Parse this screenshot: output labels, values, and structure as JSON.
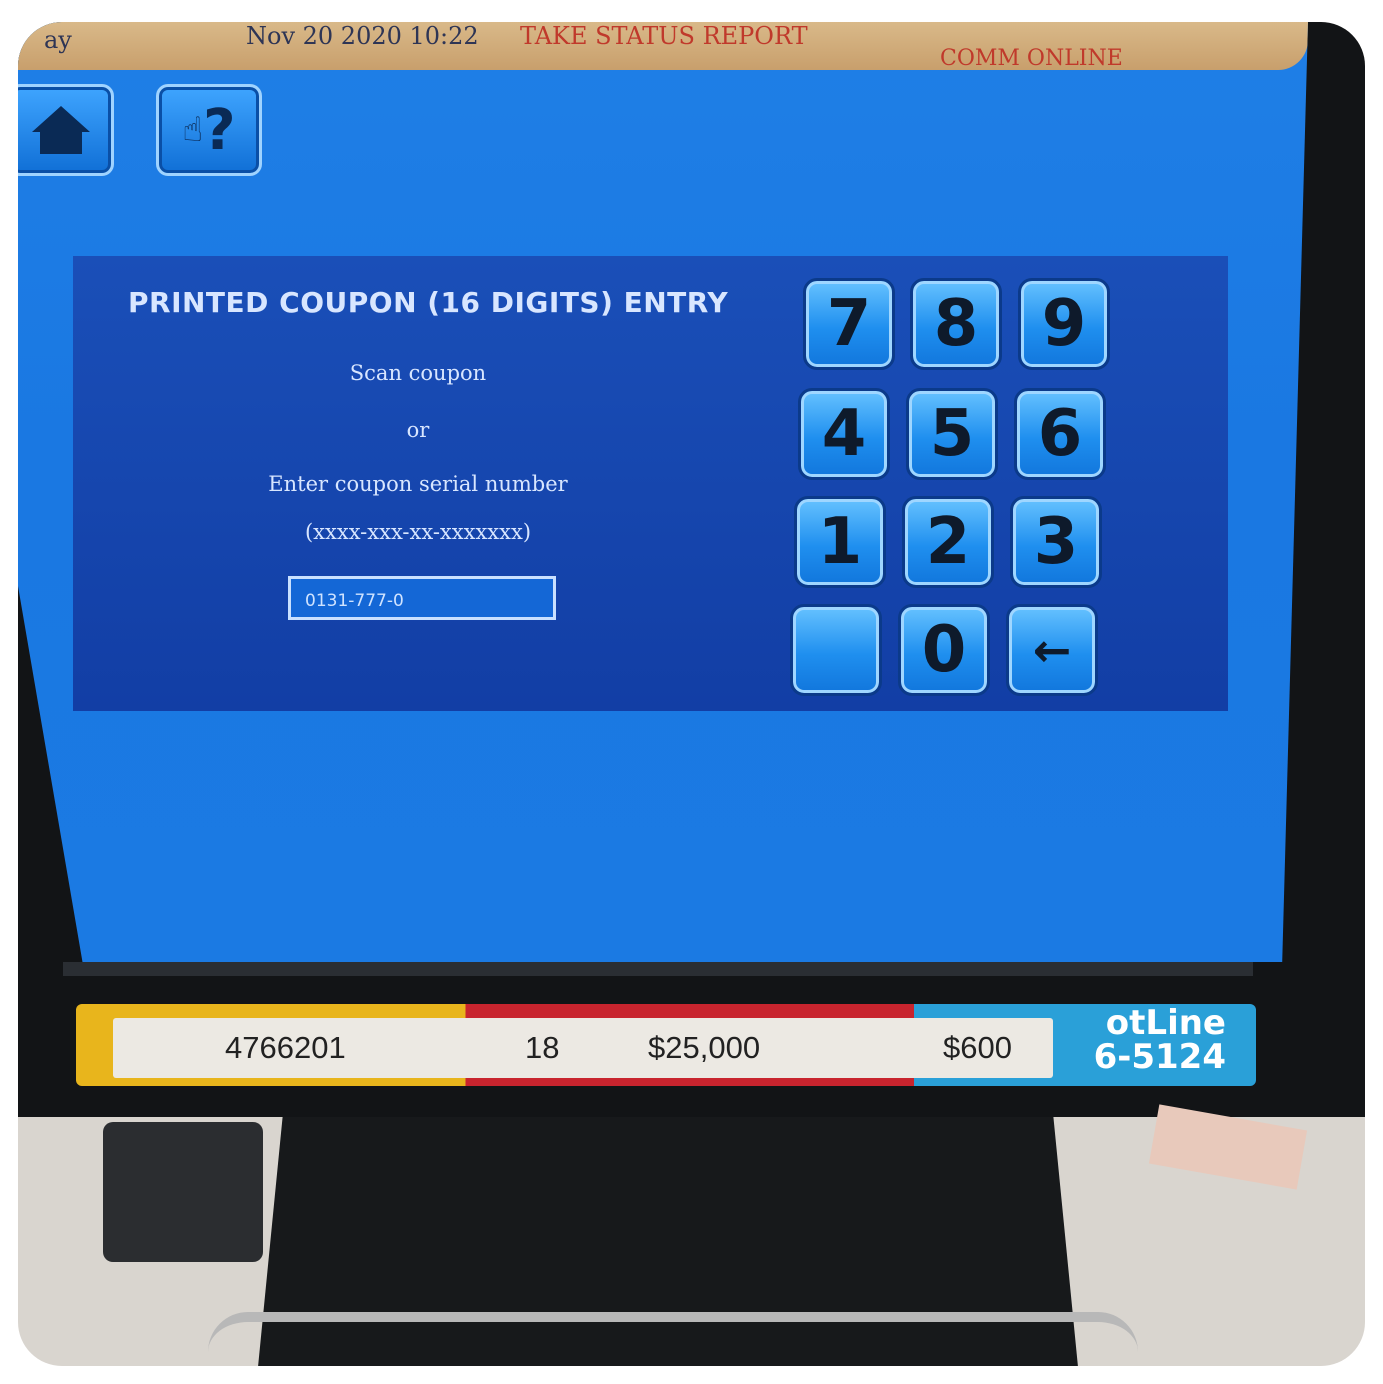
{
  "top_bar": {
    "day": "ay",
    "datetime": "Nov 20 2020  10:22",
    "status_message": "TAKE STATUS REPORT",
    "connection": "COMM ONLINE"
  },
  "toolbar": {
    "home_icon": "home-icon",
    "help_glyph": "?"
  },
  "coupon_panel": {
    "title": "PRINTED COUPON (16 DIGITS) ENTRY",
    "instruction_scan": "Scan coupon",
    "instruction_or": "or",
    "instruction_enter": "Enter coupon serial number",
    "format_hint": "(xxxx-xxx-xx-xxxxxxx)",
    "serial_input_value": "0131-777-0"
  },
  "keypad": {
    "keys": [
      "7",
      "8",
      "9",
      "4",
      "5",
      "6",
      "1",
      "2",
      "3",
      "",
      "0",
      "←"
    ]
  },
  "sticker": {
    "retailer_number": "4766201",
    "terminal_number": "18",
    "amount_1": "$25,000",
    "amount_2": "$600",
    "hotline_1": "otLine",
    "hotline_2": "6-5124"
  }
}
